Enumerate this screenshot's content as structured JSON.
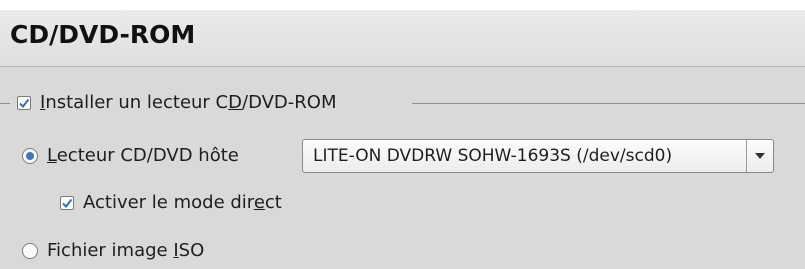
{
  "header": {
    "title": "CD/DVD-ROM"
  },
  "group": {
    "checkbox_prefix": "",
    "checkbox_u": "I",
    "checkbox_rest1": "nstaller un lecteur C",
    "checkbox_u2": "D",
    "checkbox_rest2": "/DVD-ROM",
    "checked": true
  },
  "host_drive": {
    "u": "L",
    "rest": "ecteur  CD/DVD hôte",
    "selected": true,
    "combo_value": "LITE-ON DVDRW SOHW-1693S (/dev/scd0)"
  },
  "direct_mode": {
    "pre": "Activer le mode dir",
    "u": "e",
    "post": "ct",
    "checked": true
  },
  "iso_file": {
    "pre": "Fichier image ",
    "u": "I",
    "post": "SO",
    "selected": false
  }
}
